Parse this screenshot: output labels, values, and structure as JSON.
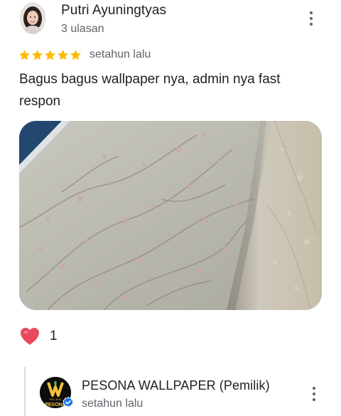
{
  "review": {
    "reviewer_name": "Putri Ayuningtyas",
    "review_count": "3 ulasan",
    "rating": 5,
    "time": "setahun lalu",
    "text": "Bagus bagus wallpaper nya, admin nya fast respon",
    "reaction_count": "1"
  },
  "owner_reply": {
    "name": "PESONA WALLPAPER (Pemilik)",
    "time": "setahun lalu",
    "logo_text": "PESONA",
    "logo_small_text": "EST. 2013"
  },
  "icons": {
    "more": "more-vert-icon",
    "star": "star-icon",
    "heart": "heart-icon",
    "verified": "verified-badge-icon"
  },
  "colors": {
    "star": "#fbbc04",
    "heart": "#e8495d",
    "verified": "#1a73e8",
    "secondary_text": "#5f6368"
  }
}
